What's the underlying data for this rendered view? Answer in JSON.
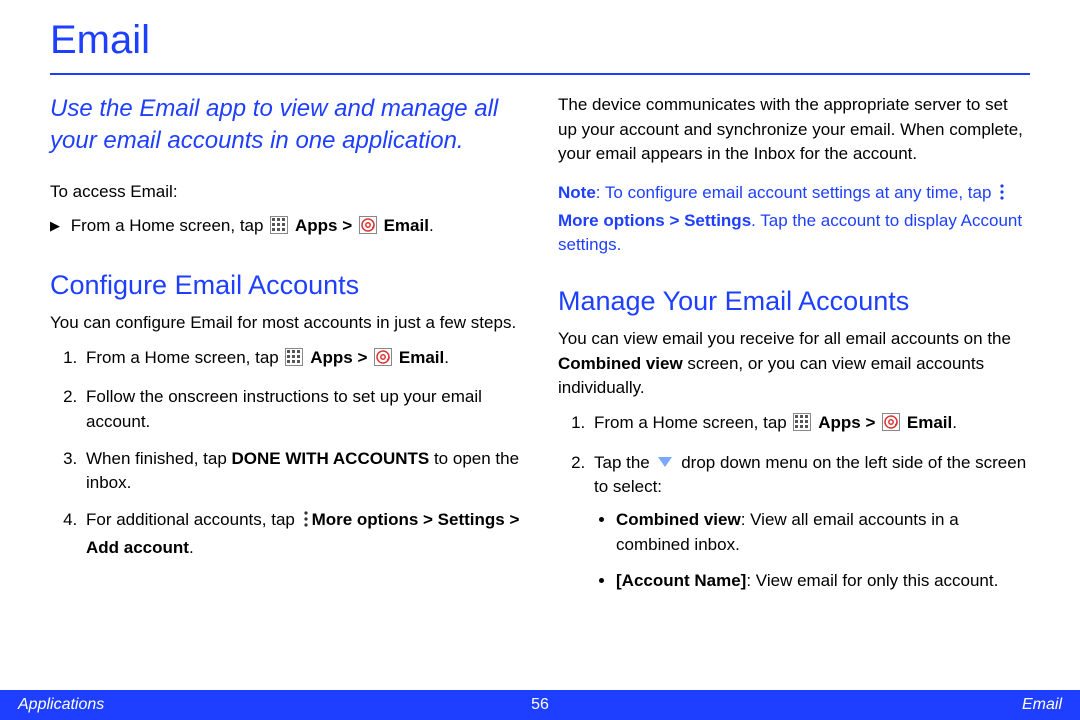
{
  "title": "Email",
  "intro": "Use the Email app to view and manage all your email accounts in one application.",
  "access": {
    "heading": "To access Email:",
    "step_prefix": "From a Home screen, tap",
    "apps_label": "Apps",
    "gt": ">",
    "email_label": "Email",
    "period": "."
  },
  "configure": {
    "heading": "Configure Email Accounts",
    "lead": "You can configure Email for most accounts in just a few steps.",
    "s1_prefix": "From a Home screen, tap",
    "s2": "Follow the onscreen instructions to set up your email account.",
    "s3_a": "When finished, tap ",
    "s3_b": "DONE WITH ACCOUNTS",
    "s3_c": " to open the inbox.",
    "s4_a": "For additional accounts, tap ",
    "s4_b": "More options > Settings > Add account",
    "s4_c": "."
  },
  "right": {
    "sync": "The device communicates with the appropriate server to set up your account and synchronize your email. When complete, your email appears in the Inbox for the account.",
    "note_a": "Note",
    "note_b": ": To configure email account settings at any time, tap ",
    "note_c": "More options > Settings",
    "note_d": ". Tap the account to display Account settings."
  },
  "manage": {
    "heading": "Manage Your Email Accounts",
    "lead_a": "You can view email you receive for all email accounts on the ",
    "lead_b": "Combined view",
    "lead_c": " screen, or you can view email accounts individually.",
    "s1_prefix": "From a Home screen, tap",
    "s2_a": "Tap the ",
    "s2_b": " drop down menu on the left side of the screen to select:",
    "b1_a": "Combined view",
    "b1_b": ": View all email accounts in a combined inbox.",
    "b2_a": "[Account Name]",
    "b2_b": ": View email for only this account."
  },
  "footer": {
    "left": "Applications",
    "center": "56",
    "right": "Email"
  }
}
